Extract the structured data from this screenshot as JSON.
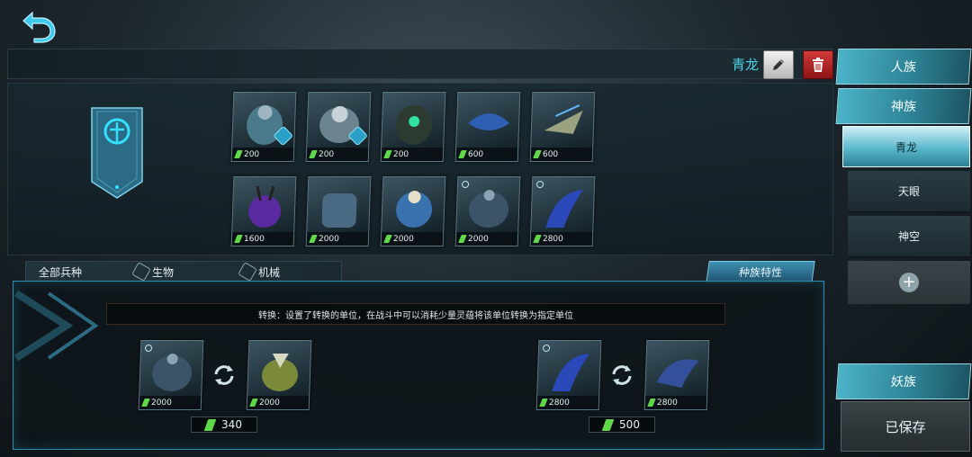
{
  "header": {
    "deck_name": "青龙"
  },
  "deck_cards_row1": [
    {
      "name": "unit-1",
      "cost": "200",
      "badge": true,
      "color": "#4a7a8c"
    },
    {
      "name": "unit-2",
      "cost": "200",
      "badge": true,
      "color": "#6c8390"
    },
    {
      "name": "unit-3",
      "cost": "200",
      "badge": false,
      "color": "#2c3a30"
    },
    {
      "name": "unit-4",
      "cost": "600",
      "badge": false,
      "color": "#2e5fb0"
    },
    {
      "name": "unit-5",
      "cost": "600",
      "badge": false,
      "color": "#9aa280"
    }
  ],
  "deck_cards_row2": [
    {
      "name": "unit-6",
      "cost": "1600",
      "color": "#5a2aa0"
    },
    {
      "name": "unit-7",
      "cost": "2000",
      "color": "#4a6a84"
    },
    {
      "name": "unit-8",
      "cost": "2000",
      "color": "#3a72b0"
    },
    {
      "name": "unit-9",
      "cost": "2000",
      "color": "#3c5468"
    },
    {
      "name": "unit-10",
      "cost": "2800",
      "color": "#2a48b8"
    }
  ],
  "filters": {
    "all": "全部兵种",
    "bio": "生物",
    "mech": "机械"
  },
  "race_traits_label": "种族特性",
  "info_text": "转换：设置了转换的单位，在战斗中可以消耗少量灵蕴将该单位转换为指定单位",
  "conversions": [
    {
      "from_cost": "2000",
      "to_cost": "2000",
      "spirit_cost": "340"
    },
    {
      "from_cost": "2800",
      "to_cost": "2800",
      "spirit_cost": "500"
    }
  ],
  "sidebar": {
    "race_human": "人族",
    "race_god": "神族",
    "race_demon": "妖族",
    "decks": [
      "青龙",
      "天眼",
      "神空"
    ],
    "saved_label": "已保存"
  },
  "colors": {
    "accent": "#4fd2e8",
    "gem": "#5fd84a",
    "delete": "#c82a2a"
  },
  "icons": {
    "back": "back-arrow-icon",
    "edit": "pencil-icon",
    "delete": "trash-icon",
    "swap": "swap-cycle-icon",
    "add": "plus-icon"
  }
}
